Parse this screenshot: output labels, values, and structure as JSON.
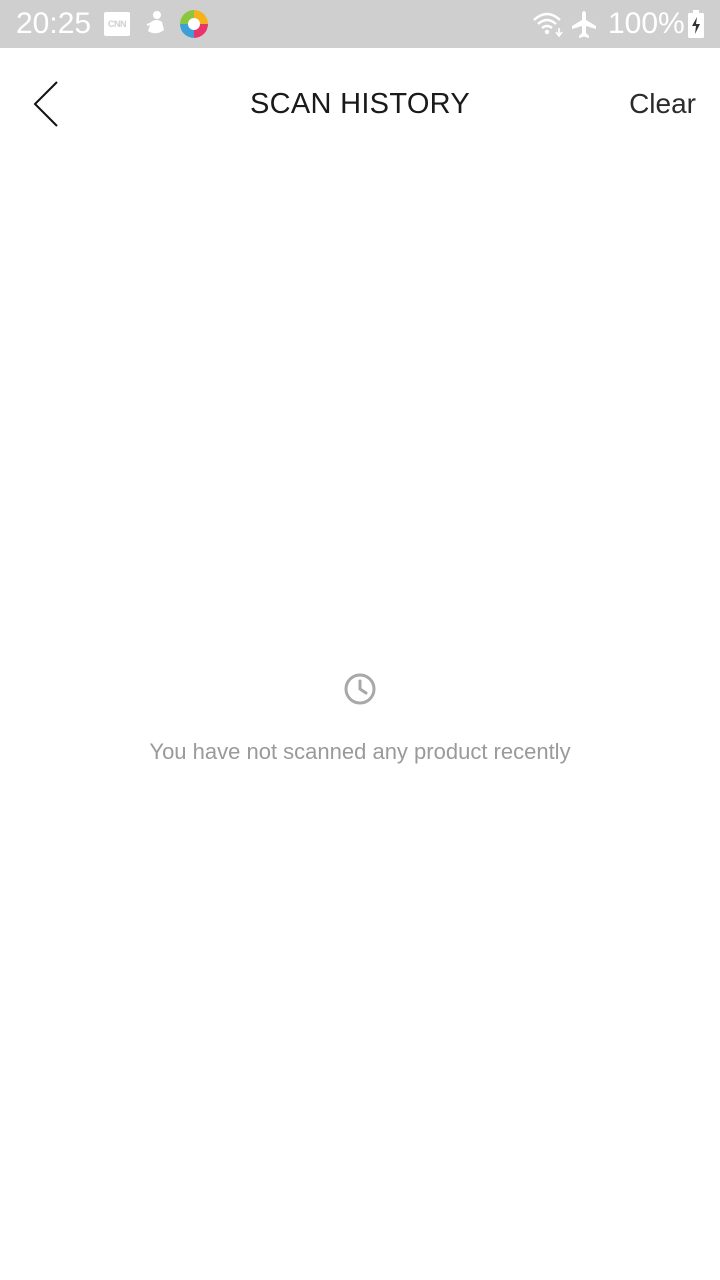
{
  "status_bar": {
    "time": "20:25",
    "notification_icons": [
      "cnn-icon",
      "figure-icon",
      "app-logo-icon"
    ],
    "cnn_label": "CNN",
    "system_icons": [
      "wifi-icon",
      "airplane-icon",
      "battery-charging-icon"
    ],
    "battery_percent": "100%"
  },
  "header": {
    "title": "SCAN HISTORY",
    "clear_label": "Clear",
    "back_icon": "chevron-left-icon"
  },
  "empty_state": {
    "icon": "clock-icon",
    "message": "You have not scanned any product recently"
  },
  "colors": {
    "status_bar_bg": "#cfcfcf",
    "background": "#ffffff",
    "title_text": "#1a1a1a",
    "muted_text": "#9a9a9a",
    "icon_gray": "#a8a8a8"
  }
}
